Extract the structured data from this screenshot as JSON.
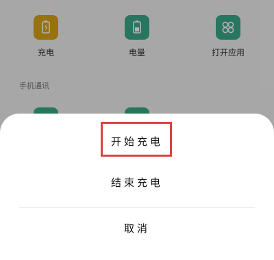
{
  "background": {
    "tiles": [
      {
        "label": "充电",
        "icon": "battery-charging-icon",
        "color": "#d8a415"
      },
      {
        "label": "电量",
        "icon": "battery-level-icon",
        "color": "#3aa98a"
      },
      {
        "label": "打开应用",
        "icon": "app-grid-icon",
        "color": "#3aa98a"
      }
    ],
    "section_label": "手机通讯"
  },
  "sheet": {
    "start_charging": "开始充电",
    "stop_charging": "结束充电",
    "cancel": "取消"
  },
  "colors": {
    "highlight": "#d9443f",
    "overlay": "rgba(0,0,0,0.30)"
  }
}
